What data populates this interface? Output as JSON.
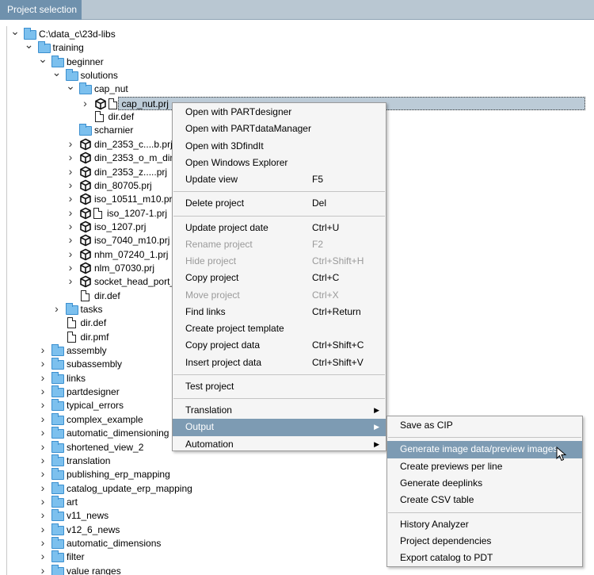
{
  "tab": {
    "label": "Project selection"
  },
  "tree": [
    {
      "id": "root",
      "label": "C:\\data_c\\23d-libs",
      "depth": 0,
      "chev": "expanded",
      "icon": "folder"
    },
    {
      "id": "training",
      "label": "training",
      "depth": 1,
      "chev": "expanded",
      "icon": "folder"
    },
    {
      "id": "beginner",
      "label": "beginner",
      "depth": 2,
      "chev": "expanded",
      "icon": "folder"
    },
    {
      "id": "solutions",
      "label": "solutions",
      "depth": 3,
      "chev": "expanded",
      "icon": "folder"
    },
    {
      "id": "cap_nut",
      "label": "cap_nut",
      "depth": 4,
      "chev": "expanded",
      "icon": "folder"
    },
    {
      "id": "cap_nut_prj",
      "label": "cap_nut.prj",
      "depth": 5,
      "chev": "collapsed",
      "icon": "cube-doc",
      "selected": true
    },
    {
      "id": "dir_def_1",
      "label": "dir.def",
      "depth": 5,
      "chev": "none",
      "icon": "doc"
    },
    {
      "id": "scharnier",
      "label": "scharnier",
      "depth": 4,
      "chev": "none",
      "icon": "folder"
    },
    {
      "id": "din_2353_c",
      "label": "din_2353_c....b.prj",
      "depth": 4,
      "chev": "collapsed",
      "icon": "cube"
    },
    {
      "id": "din_2353_o",
      "label": "din_2353_o_m_din_",
      "depth": 4,
      "chev": "collapsed",
      "icon": "cube"
    },
    {
      "id": "din_2353_z",
      "label": "din_2353_z.....prj",
      "depth": 4,
      "chev": "collapsed",
      "icon": "cube"
    },
    {
      "id": "din_80705",
      "label": "din_80705.prj",
      "depth": 4,
      "chev": "collapsed",
      "icon": "cube"
    },
    {
      "id": "iso_10511",
      "label": "iso_10511_m10.prj",
      "depth": 4,
      "chev": "collapsed",
      "icon": "cube"
    },
    {
      "id": "iso_1207_1",
      "label": "iso_1207-1.prj",
      "depth": 4,
      "chev": "collapsed",
      "icon": "cube-doc"
    },
    {
      "id": "iso_1207",
      "label": "iso_1207.prj",
      "depth": 4,
      "chev": "collapsed",
      "icon": "cube"
    },
    {
      "id": "iso_7040",
      "label": "iso_7040_m10.prj",
      "depth": 4,
      "chev": "collapsed",
      "icon": "cube"
    },
    {
      "id": "nhm_07240",
      "label": "nhm_07240_1.prj",
      "depth": 4,
      "chev": "collapsed",
      "icon": "cube"
    },
    {
      "id": "nlm_07030",
      "label": "nlm_07030.prj",
      "depth": 4,
      "chev": "collapsed",
      "icon": "cube"
    },
    {
      "id": "socket_head",
      "label": "socket_head_port_",
      "depth": 4,
      "chev": "collapsed",
      "icon": "cube"
    },
    {
      "id": "dir_def_2",
      "label": "dir.def",
      "depth": 4,
      "chev": "none",
      "icon": "doc"
    },
    {
      "id": "tasks",
      "label": "tasks",
      "depth": 3,
      "chev": "collapsed",
      "icon": "folder"
    },
    {
      "id": "dir_def_3",
      "label": "dir.def",
      "depth": 3,
      "chev": "none",
      "icon": "doc"
    },
    {
      "id": "dir_pmf",
      "label": "dir.pmf",
      "depth": 3,
      "chev": "none",
      "icon": "doc"
    },
    {
      "id": "assembly",
      "label": "assembly",
      "depth": 2,
      "chev": "collapsed",
      "icon": "folder"
    },
    {
      "id": "subassembly",
      "label": "subassembly",
      "depth": 2,
      "chev": "collapsed",
      "icon": "folder"
    },
    {
      "id": "links",
      "label": "links",
      "depth": 2,
      "chev": "collapsed",
      "icon": "folder"
    },
    {
      "id": "partdesigner",
      "label": "partdesigner",
      "depth": 2,
      "chev": "collapsed",
      "icon": "folder"
    },
    {
      "id": "typical_errors",
      "label": "typical_errors",
      "depth": 2,
      "chev": "collapsed",
      "icon": "folder"
    },
    {
      "id": "complex_example",
      "label": "complex_example",
      "depth": 2,
      "chev": "collapsed",
      "icon": "folder"
    },
    {
      "id": "automatic_dimensioning",
      "label": "automatic_dimensioning",
      "depth": 2,
      "chev": "collapsed",
      "icon": "folder"
    },
    {
      "id": "shortened_view_2",
      "label": "shortened_view_2",
      "depth": 2,
      "chev": "collapsed",
      "icon": "folder"
    },
    {
      "id": "translation",
      "label": "translation",
      "depth": 2,
      "chev": "collapsed",
      "icon": "folder"
    },
    {
      "id": "publishing_erp_mapping",
      "label": "publishing_erp_mapping",
      "depth": 2,
      "chev": "collapsed",
      "icon": "folder"
    },
    {
      "id": "catalog_update_erp_mapping",
      "label": "catalog_update_erp_mapping",
      "depth": 2,
      "chev": "collapsed",
      "icon": "folder"
    },
    {
      "id": "art",
      "label": "art",
      "depth": 2,
      "chev": "collapsed",
      "icon": "folder"
    },
    {
      "id": "v11_news",
      "label": "v11_news",
      "depth": 2,
      "chev": "collapsed",
      "icon": "folder"
    },
    {
      "id": "v12_6_news",
      "label": "v12_6_news",
      "depth": 2,
      "chev": "collapsed",
      "icon": "folder"
    },
    {
      "id": "automatic_dimensions",
      "label": "automatic_dimensions",
      "depth": 2,
      "chev": "collapsed",
      "icon": "folder"
    },
    {
      "id": "filter",
      "label": "filter",
      "depth": 2,
      "chev": "collapsed",
      "icon": "folder"
    },
    {
      "id": "value_ranges",
      "label": "value ranges",
      "depth": 2,
      "chev": "collapsed",
      "icon": "folder"
    }
  ],
  "context_menu": {
    "items": [
      {
        "label": "Open with PARTdesigner",
        "shortcut": ""
      },
      {
        "label": "Open with PARTdataManager",
        "shortcut": ""
      },
      {
        "label": "Open with 3DfindIt",
        "shortcut": ""
      },
      {
        "label": "Open Windows Explorer",
        "shortcut": ""
      },
      {
        "label": "Update view",
        "shortcut": "F5"
      },
      {
        "sep": true
      },
      {
        "label": "Delete project",
        "shortcut": "Del"
      },
      {
        "sep": true
      },
      {
        "label": "Update project date",
        "shortcut": "Ctrl+U"
      },
      {
        "label": "Rename project",
        "shortcut": "F2",
        "disabled": true
      },
      {
        "label": "Hide project",
        "shortcut": "Ctrl+Shift+H",
        "disabled": true
      },
      {
        "label": "Copy project",
        "shortcut": "Ctrl+C"
      },
      {
        "label": "Move project",
        "shortcut": "Ctrl+X",
        "disabled": true
      },
      {
        "label": "Find links",
        "shortcut": "Ctrl+Return"
      },
      {
        "label": "Create project template",
        "shortcut": ""
      },
      {
        "label": "Copy project data",
        "shortcut": "Ctrl+Shift+C"
      },
      {
        "label": "Insert project data",
        "shortcut": "Ctrl+Shift+V"
      },
      {
        "sep": true
      },
      {
        "label": "Test project",
        "shortcut": ""
      },
      {
        "sep": true
      },
      {
        "label": "Translation",
        "shortcut": "",
        "submenu": true
      },
      {
        "label": "Output",
        "shortcut": "",
        "submenu": true,
        "highlighted": true
      },
      {
        "label": "Automation",
        "shortcut": "",
        "submenu": true
      }
    ]
  },
  "output_submenu": {
    "items": [
      {
        "label": "Save as CIP"
      },
      {
        "sep": true
      },
      {
        "label": "Generate image data/preview images",
        "highlighted": true
      },
      {
        "label": "Create previews per line"
      },
      {
        "label": "Generate deeplinks"
      },
      {
        "label": "Create CSV table"
      },
      {
        "sep": true
      },
      {
        "label": "History Analyzer"
      },
      {
        "label": "Project dependencies"
      },
      {
        "label": "Export catalog to PDT"
      }
    ]
  },
  "colors": {
    "tab_active": "#6f91ad",
    "highlight": "#7d9bb3",
    "folder": "#7cc0ee",
    "selection": "#bccbd7"
  }
}
